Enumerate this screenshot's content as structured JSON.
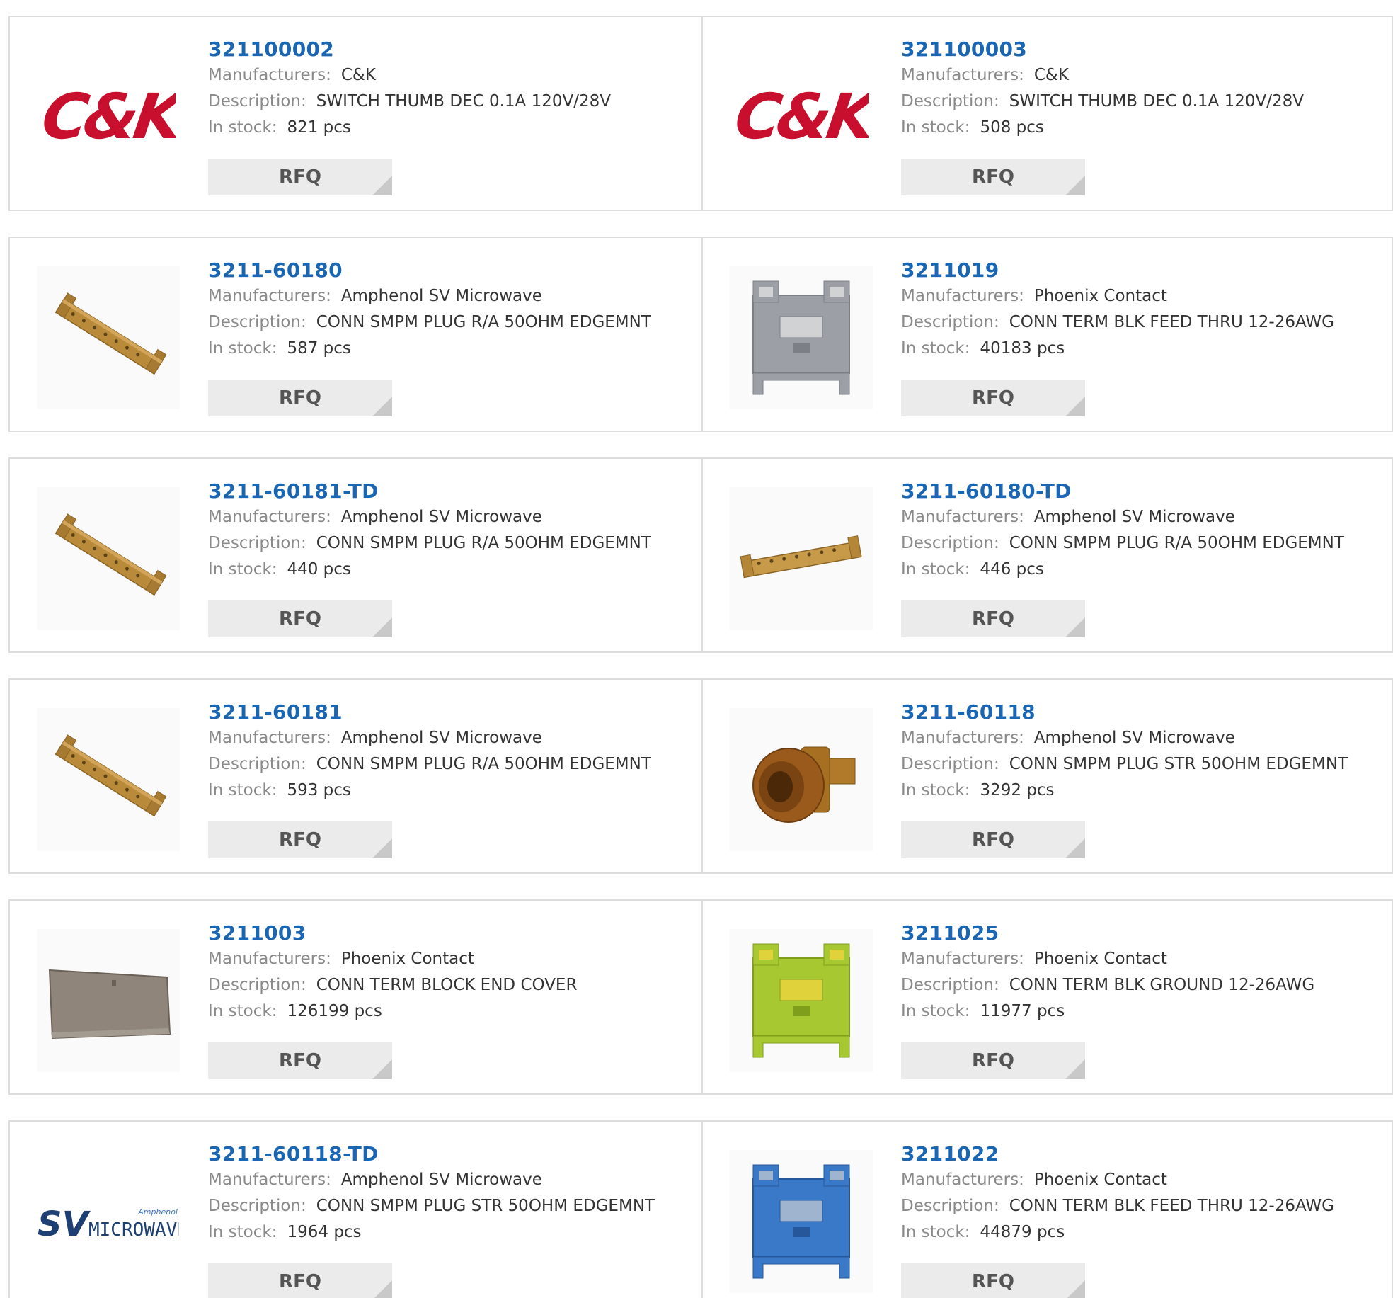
{
  "labels": {
    "manufacturers": "Manufacturers:",
    "description": "Description:",
    "in_stock": "In stock:",
    "rfq": "RFQ"
  },
  "products": [
    {
      "pn": "321100002",
      "manufacturer": "C&K",
      "description": "SWITCH THUMB DEC 0.1A 120V/28V",
      "stock": "821 pcs",
      "image": "ck-logo"
    },
    {
      "pn": "321100003",
      "manufacturer": "C&K",
      "description": "SWITCH THUMB DEC 0.1A 120V/28V",
      "stock": "508 pcs",
      "image": "ck-logo"
    },
    {
      "pn": "3211-60180",
      "manufacturer": "Amphenol SV Microwave",
      "description": "CONN SMPM PLUG R/A 50OHM EDGEMNT",
      "stock": "587 pcs",
      "image": "edge-connector-bar"
    },
    {
      "pn": "3211019",
      "manufacturer": "Phoenix Contact",
      "description": "CONN TERM BLK FEED THRU 12-26AWG",
      "stock": "40183 pcs",
      "image": "terminal-block-gray"
    },
    {
      "pn": "3211-60181-TD",
      "manufacturer": "Amphenol SV Microwave",
      "description": "CONN SMPM PLUG R/A 50OHM EDGEMNT",
      "stock": "440 pcs",
      "image": "edge-connector-bar"
    },
    {
      "pn": "3211-60180-TD",
      "manufacturer": "Amphenol SV Microwave",
      "description": "CONN SMPM PLUG R/A 50OHM EDGEMNT",
      "stock": "446 pcs",
      "image": "edge-connector-bar-flat"
    },
    {
      "pn": "3211-60181",
      "manufacturer": "Amphenol SV Microwave",
      "description": "CONN SMPM PLUG R/A 50OHM EDGEMNT",
      "stock": "593 pcs",
      "image": "edge-connector-bar"
    },
    {
      "pn": "3211-60118",
      "manufacturer": "Amphenol SV Microwave",
      "description": "CONN SMPM PLUG STR 50OHM EDGEMNT",
      "stock": "3292 pcs",
      "image": "smpm-plug"
    },
    {
      "pn": "3211003",
      "manufacturer": "Phoenix Contact",
      "description": "CONN TERM BLOCK END COVER",
      "stock": "126199 pcs",
      "image": "end-cover"
    },
    {
      "pn": "3211025",
      "manufacturer": "Phoenix Contact",
      "description": "CONN TERM BLK GROUND 12-26AWG",
      "stock": "11977 pcs",
      "image": "terminal-block-green"
    },
    {
      "pn": "3211-60118-TD",
      "manufacturer": "Amphenol SV Microwave",
      "description": "CONN SMPM PLUG STR 50OHM EDGEMNT",
      "stock": "1964 pcs",
      "image": "sv-microwave-logo"
    },
    {
      "pn": "3211022",
      "manufacturer": "Phoenix Contact",
      "description": "CONN TERM BLK FEED THRU 12-26AWG",
      "stock": "44879 pcs",
      "image": "terminal-block-blue"
    }
  ],
  "logos": {
    "ck": "C&K",
    "sv_prefix": "SV",
    "sv_word": "MICROWAVE",
    "sv_brand": "Amphenol"
  },
  "colors": {
    "link": "#1a66b2",
    "ck_red": "#c8102e",
    "sv_navy": "#1d3f73",
    "border": "#dcdcdc",
    "button_bg": "#ebebeb"
  }
}
